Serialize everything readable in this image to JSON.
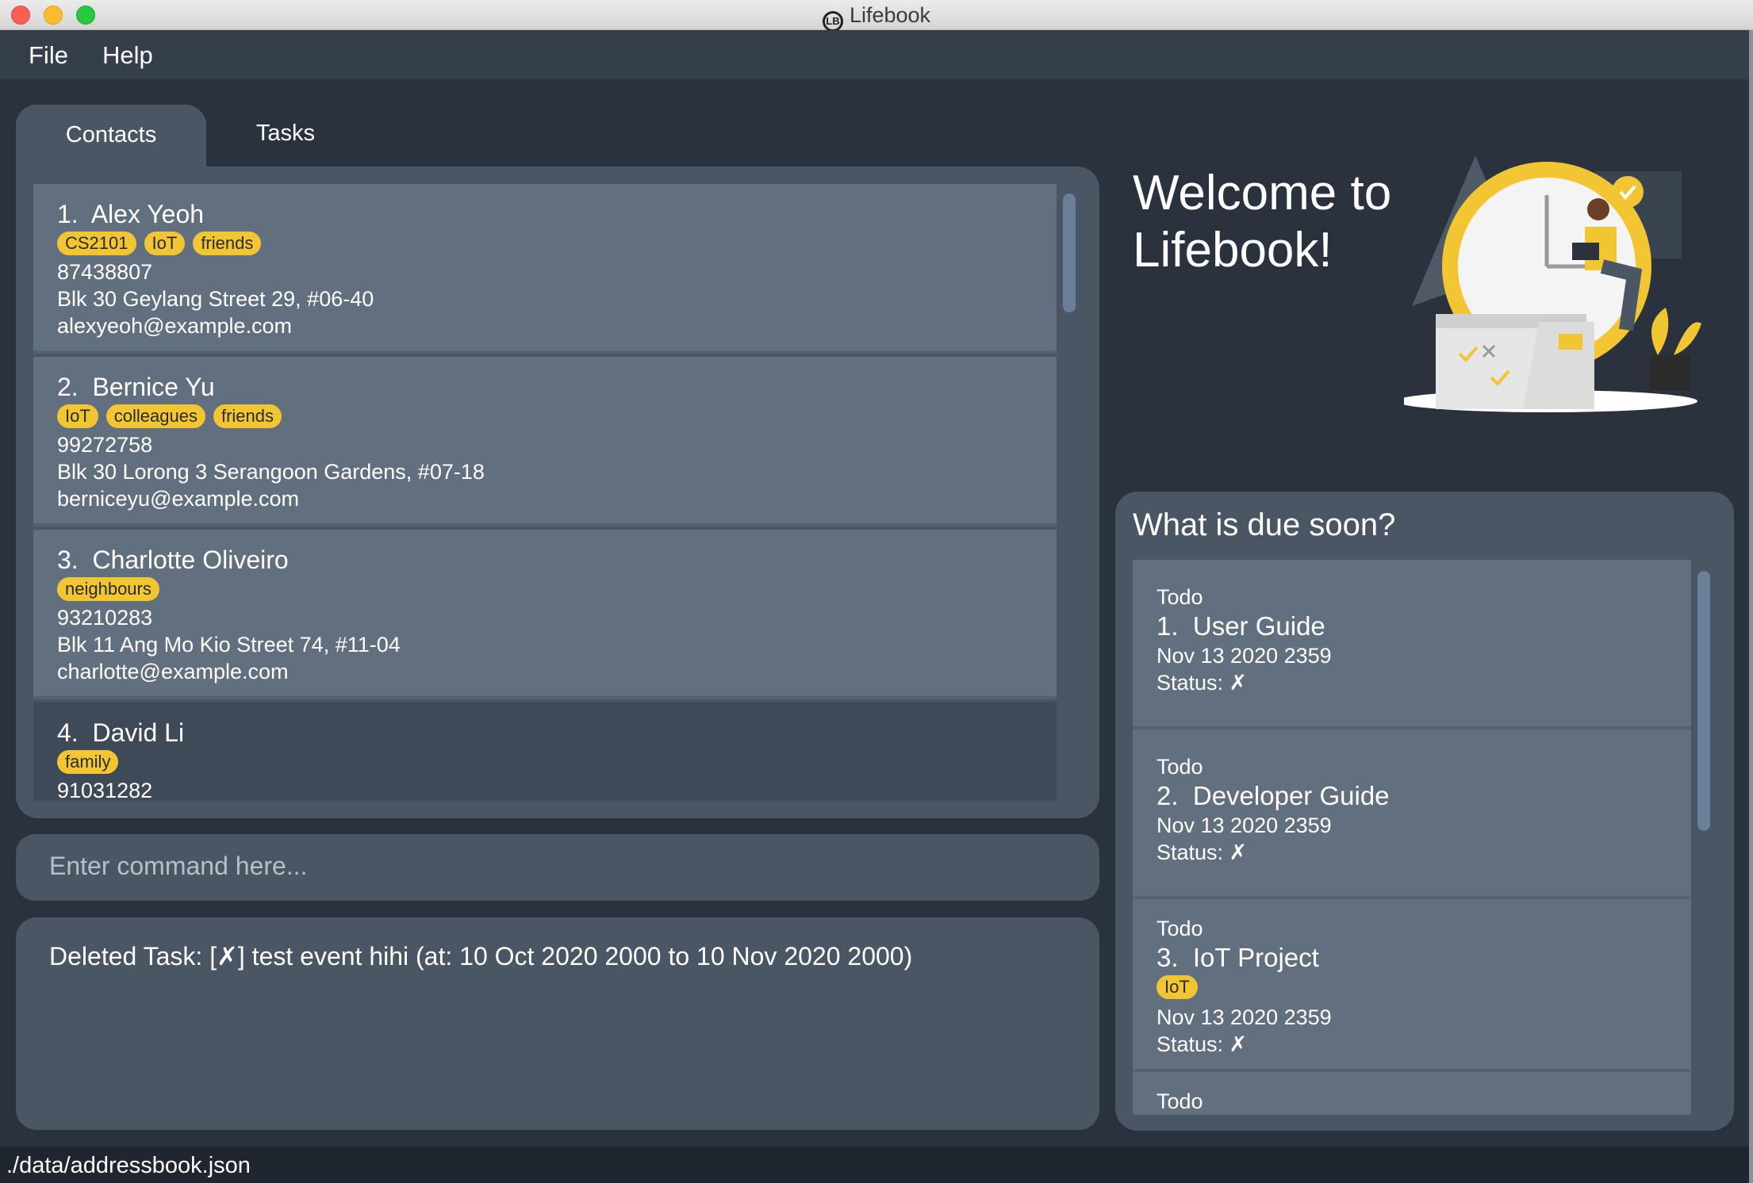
{
  "window": {
    "title": "Lifebook",
    "logo_text": "LB"
  },
  "menu": {
    "file": "File",
    "help": "Help"
  },
  "tabs": {
    "contacts": "Contacts",
    "tasks": "Tasks"
  },
  "contacts": [
    {
      "index": "1.",
      "name": "Alex Yeoh",
      "tags": [
        "CS2101",
        "IoT",
        "friends"
      ],
      "phone": "87438807",
      "address": "Blk 30 Geylang Street 29, #06-40",
      "email": "alexyeoh@example.com"
    },
    {
      "index": "2.",
      "name": "Bernice Yu",
      "tags": [
        "IoT",
        "colleagues",
        "friends"
      ],
      "phone": "99272758",
      "address": "Blk 30 Lorong 3 Serangoon Gardens, #07-18",
      "email": "berniceyu@example.com"
    },
    {
      "index": "3.",
      "name": "Charlotte Oliveiro",
      "tags": [
        "neighbours"
      ],
      "phone": "93210283",
      "address": "Blk 11 Ang Mo Kio Street 74, #11-04",
      "email": "charlotte@example.com"
    },
    {
      "index": "4.",
      "name": "David Li",
      "tags": [
        "family"
      ],
      "phone": "91031282"
    }
  ],
  "command_box": {
    "placeholder": "Enter command here..."
  },
  "result": "Deleted Task: [✗] test event hihi (at: 10 Oct 2020 2000 to 10 Nov 2020 2000)",
  "welcome": {
    "line1": "Welcome to",
    "line2": "Lifebook!"
  },
  "due_soon": {
    "title": "What is due soon?",
    "tasks": [
      {
        "type": "Todo",
        "index": "1.",
        "name": "User Guide",
        "tags": [],
        "date": "Nov 13 2020 2359",
        "status": "Status: ✗"
      },
      {
        "type": "Todo",
        "index": "2.",
        "name": "Developer Guide",
        "tags": [],
        "date": "Nov 13 2020 2359",
        "status": "Status: ✗"
      },
      {
        "type": "Todo",
        "index": "3.",
        "name": "IoT Project",
        "tags": [
          "IoT"
        ],
        "date": "Nov 13 2020 2359",
        "status": "Status: ✗"
      },
      {
        "type": "Todo"
      }
    ]
  },
  "status_bar": {
    "path": "./data/addressbook.json"
  },
  "colors": {
    "background": "#2a323d",
    "panel": "#4a5664",
    "card": "#626f7e",
    "tag": "#f2c633",
    "accent": "#f2c633"
  }
}
